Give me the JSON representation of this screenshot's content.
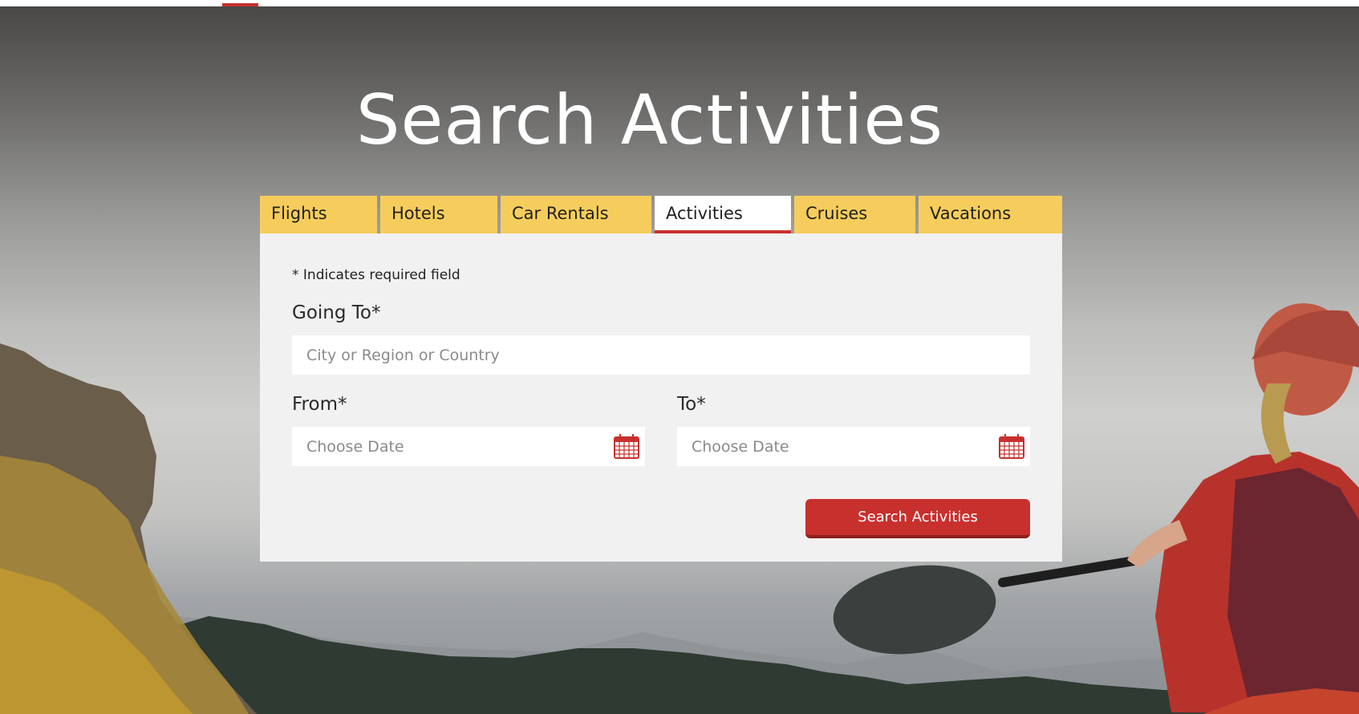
{
  "page": {
    "title": "Search Activities"
  },
  "tabs": [
    {
      "label": "Flights",
      "active": false
    },
    {
      "label": "Hotels",
      "active": false
    },
    {
      "label": "Car Rentals",
      "active": false
    },
    {
      "label": "Activities",
      "active": true
    },
    {
      "label": "Cruises",
      "active": false
    },
    {
      "label": "Vacations",
      "active": false
    }
  ],
  "form": {
    "required_note": "* Indicates required field",
    "going_to": {
      "label": "Going To*",
      "placeholder": "City or Region or Country",
      "value": ""
    },
    "from": {
      "label": "From*",
      "placeholder": "Choose Date",
      "value": "",
      "icon": "calendar-icon"
    },
    "to": {
      "label": "To*",
      "placeholder": "Choose Date",
      "value": "",
      "icon": "calendar-icon"
    },
    "submit_label": "Search Activities"
  },
  "colors": {
    "accent": "#c8302e",
    "tab_bg": "#f6cd5c",
    "panel_bg": "#f1f1f1"
  }
}
